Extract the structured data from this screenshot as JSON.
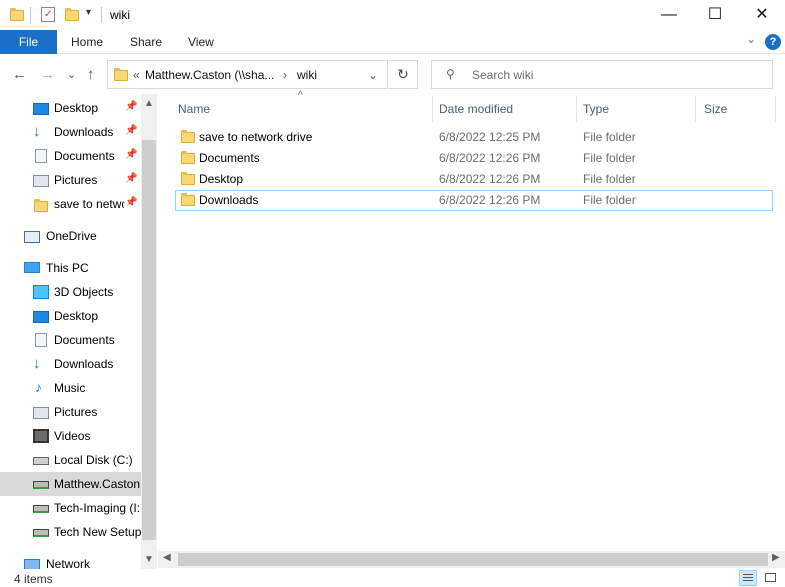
{
  "window": {
    "title": "wiki",
    "minimize": "—",
    "maximize": "☐",
    "close": "✕"
  },
  "ribbon": {
    "tabs": [
      "File",
      "Home",
      "Share",
      "View"
    ],
    "help": "?",
    "collapse": "⌄"
  },
  "navigation": {
    "back": "←",
    "forward": "→",
    "recent": "⌄",
    "up": "↑",
    "breadcrumb_overflow": "«",
    "breadcrumb": [
      "Matthew.Caston (\\\\sha...",
      "wiki"
    ],
    "breadcrumb_sep": "›",
    "dropdown": "⌄",
    "refresh": "↻",
    "search_placeholder": "Search wiki"
  },
  "sidebar": {
    "quick_access": [
      {
        "label": "Desktop",
        "icon": "desktop-icon",
        "pinned": true
      },
      {
        "label": "Downloads",
        "icon": "downloads-icon",
        "pinned": true
      },
      {
        "label": "Documents",
        "icon": "documents-icon",
        "pinned": true
      },
      {
        "label": "Pictures",
        "icon": "pictures-icon",
        "pinned": true
      },
      {
        "label": "save to netwo",
        "icon": "folder-icon",
        "pinned": true
      }
    ],
    "onedrive": {
      "label": "OneDrive",
      "icon": "onedrive-icon"
    },
    "this_pc": {
      "label": "This PC",
      "icon": "this-pc-icon"
    },
    "pc_items": [
      {
        "label": "3D Objects",
        "icon": "3d-objects-icon"
      },
      {
        "label": "Desktop",
        "icon": "desktop-icon"
      },
      {
        "label": "Documents",
        "icon": "documents-icon"
      },
      {
        "label": "Downloads",
        "icon": "downloads-icon"
      },
      {
        "label": "Music",
        "icon": "music-icon"
      },
      {
        "label": "Pictures",
        "icon": "pictures-icon"
      },
      {
        "label": "Videos",
        "icon": "videos-icon"
      },
      {
        "label": "Local Disk (C:)",
        "icon": "local-disk-icon"
      },
      {
        "label": "Matthew.Caston",
        "icon": "network-drive-icon",
        "selected": true
      },
      {
        "label": "Tech-Imaging (I:",
        "icon": "network-drive-icon"
      },
      {
        "label": "Tech New Setup",
        "icon": "network-drive-icon"
      }
    ],
    "network": {
      "label": "Network",
      "icon": "network-icon"
    },
    "pin_glyph": "📌"
  },
  "content": {
    "columns": [
      "Name",
      "Date modified",
      "Type",
      "Size"
    ],
    "sort_indicator": "^",
    "rows": [
      {
        "name": "save to network drive",
        "date": "6/8/2022 12:25 PM",
        "type": "File folder",
        "size": ""
      },
      {
        "name": "Documents",
        "date": "6/8/2022 12:26 PM",
        "type": "File folder",
        "size": ""
      },
      {
        "name": "Desktop",
        "date": "6/8/2022 12:26 PM",
        "type": "File folder",
        "size": ""
      },
      {
        "name": "Downloads",
        "date": "6/8/2022 12:26 PM",
        "type": "File folder",
        "size": ""
      }
    ]
  },
  "status": {
    "item_count": "4 items"
  },
  "colors": {
    "accent": "#1a6fc7",
    "selection": "#cce8ff",
    "folder": "#f8d775"
  }
}
